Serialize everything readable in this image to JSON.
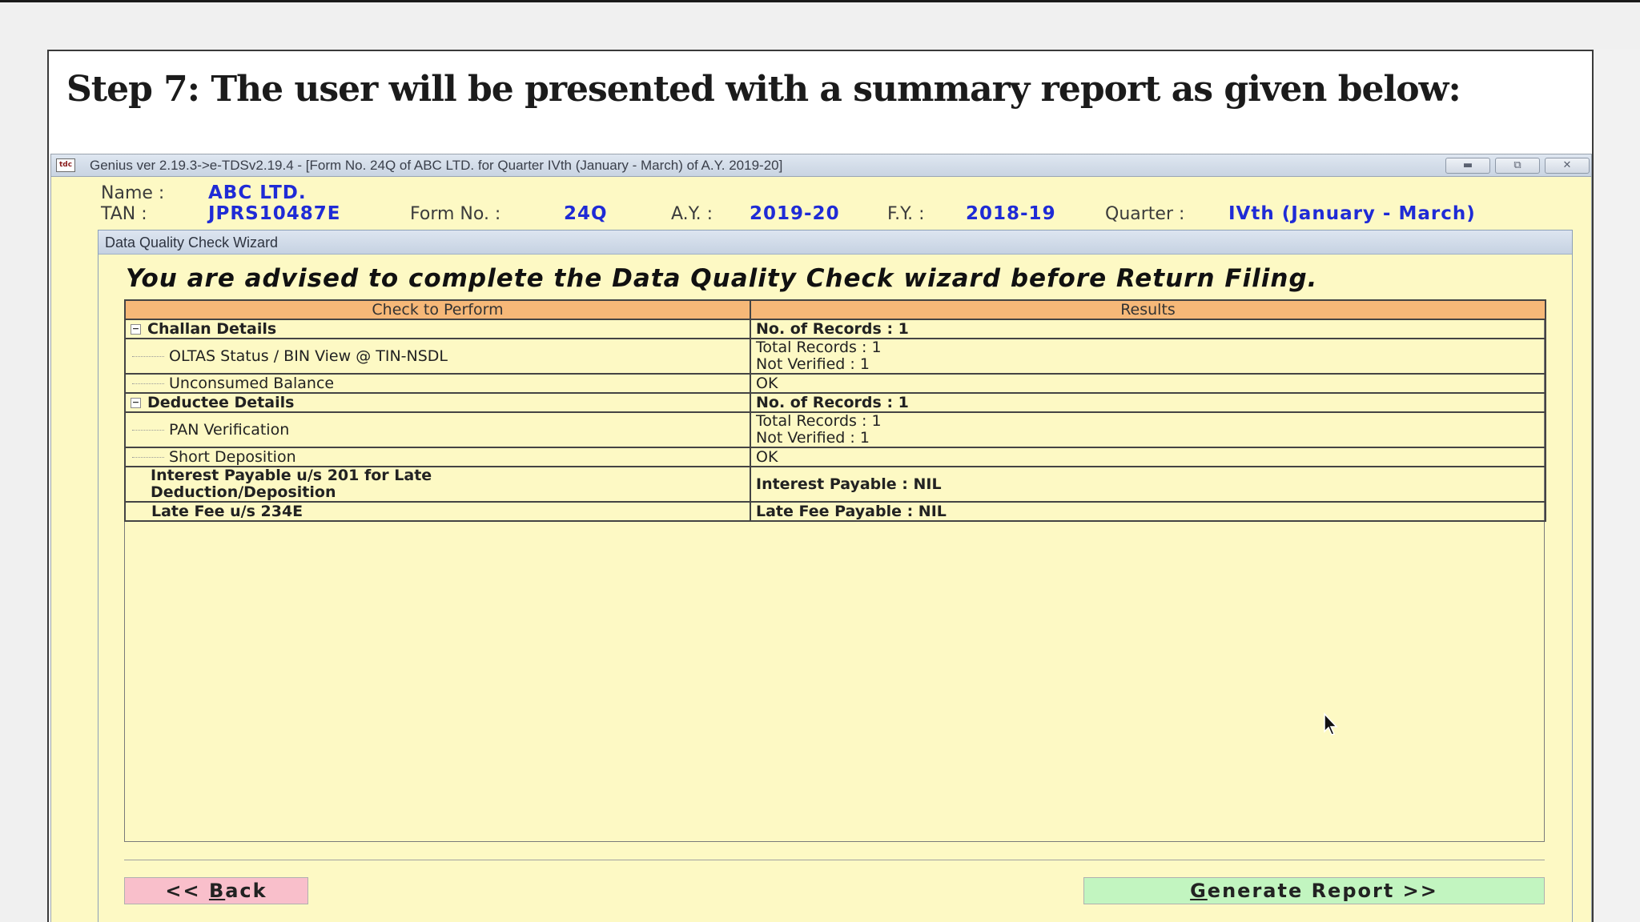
{
  "slide": {
    "step_title": "Step 7: The user will be presented with a summary report as given below:"
  },
  "window": {
    "icon_text": "tdc",
    "title": "Genius ver 2.19.3->e-TDSv2.19.4 - [Form No. 24Q of ABC LTD. for Quarter IVth (January - March) of A.Y. 2019-20]",
    "controls": [
      "minimize-icon",
      "restore-icon",
      "close-icon"
    ]
  },
  "header": {
    "name_label": "Name :",
    "name_value": "ABC LTD.",
    "tan_label": "TAN :",
    "tan_value": "JPRS10487E",
    "form_label": "Form No. :",
    "form_value": "24Q",
    "ay_label": "A.Y. :",
    "ay_value": "2019-20",
    "fy_label": "F.Y. :",
    "fy_value": "2018-19",
    "quarter_label": "Quarter :",
    "quarter_value": "IVth (January - March)"
  },
  "wizard": {
    "caption": "Data Quality Check Wizard",
    "advice": "You are advised to complete the Data Quality Check wizard before Return Filing.",
    "columns": [
      "Check to Perform",
      "Results"
    ],
    "rows": [
      {
        "check": "Challan Details",
        "result_1": "No. of Records : 1",
        "result_2": ""
      },
      {
        "check": "OLTAS Status / BIN View @ TIN-NSDL",
        "result_1": "Total Records : 1",
        "result_2": "Not Verified : 1"
      },
      {
        "check": "Unconsumed Balance",
        "result_1": "OK",
        "result_2": ""
      },
      {
        "check": "Deductee Details",
        "result_1": "No. of Records : 1",
        "result_2": ""
      },
      {
        "check": "PAN Verification",
        "result_1": "Total Records : 1",
        "result_2": "Not Verified : 1"
      },
      {
        "check": "Short Deposition",
        "result_1": "OK",
        "result_2": ""
      },
      {
        "check_1": "Interest Payable u/s 201 for Late",
        "check_2": "Deduction/Deposition",
        "result_1": "Interest Payable : NIL"
      },
      {
        "check": "Late Fee u/s 234E",
        "result_1": "Late Fee Payable : NIL"
      }
    ],
    "back_button": {
      "prefix": "<< ",
      "accel": "B",
      "rest": "ack"
    },
    "generate_button": {
      "accel": "G",
      "rest": "enerate Report >>"
    }
  }
}
